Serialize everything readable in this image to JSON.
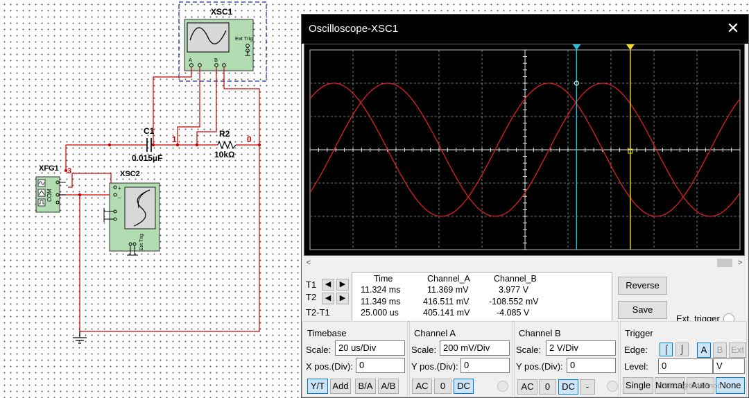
{
  "schematic": {
    "xsc1_label": "XSC1",
    "xsc2_label": "XSC2",
    "xfg1_label": "XFG1",
    "c1_name": "C1",
    "c1_value": "0.015µF",
    "r2_name": "R2",
    "r2_value": "10kΩ",
    "node_1": "1",
    "node_0": "0",
    "node_3": "3",
    "ext_trig": "Ext Trig",
    "terminal_a": "A",
    "terminal_b": "B",
    "com_label": "COM",
    "plus_sign": "+",
    "minus_sign": "_",
    "wire_color": "#cc0000"
  },
  "window": {
    "title": "Oscilloscope-XSC1",
    "close_glyph": "✕",
    "scroll_left": "<",
    "scroll_right": ">"
  },
  "cursors": {
    "t1": "T1",
    "t2": "T2",
    "t2t1": "T2-T1",
    "left_glyph": "◀",
    "right_glyph": "▶",
    "t1_color": "#22c5e0",
    "t2_color": "#f0e02a"
  },
  "readout": {
    "headers": [
      "Time",
      "Channel_A",
      "Channel_B"
    ],
    "rows": [
      [
        "11.324 ms",
        "11.369 mV",
        "3.977 V"
      ],
      [
        "11.349 ms",
        "416.511 mV",
        "-108.552 mV"
      ],
      [
        "25.000 us",
        "405.141 mV",
        "-4.085 V"
      ]
    ]
  },
  "buttons": {
    "reverse": "Reverse",
    "save": "Save",
    "ext_trigger": "Ext. trigger"
  },
  "timebase": {
    "title": "Timebase",
    "scale_label": "Scale:",
    "scale_value": "20 us/Div",
    "xpos_label": "X pos.(Div):",
    "xpos_value": "0",
    "modes": [
      "Y/T",
      "Add",
      "B/A",
      "A/B"
    ],
    "active_mode": "Y/T"
  },
  "channel_a": {
    "title": "Channel A",
    "scale_label": "Scale:",
    "scale_value": "200 mV/Div",
    "ypos_label": "Y pos.(Div):",
    "ypos_value": "0",
    "coupling": [
      "AC",
      "0",
      "DC"
    ],
    "active_coupling": "DC"
  },
  "channel_b": {
    "title": "Channel B",
    "scale_label": "Scale:",
    "scale_value": "2  V/Div",
    "ypos_label": "Y pos.(Div):",
    "ypos_value": "0",
    "coupling": [
      "AC",
      "0",
      "DC",
      "-"
    ],
    "active_coupling": "DC"
  },
  "trigger": {
    "title": "Trigger",
    "edge_label": "Edge:",
    "edge_rising": "⌠",
    "edge_falling": "⌡",
    "sources": [
      "A",
      "B",
      "Ext"
    ],
    "active_source": "A",
    "level_label": "Level:",
    "level_value": "0",
    "level_unit": "V",
    "modes": [
      "Single",
      "Normal",
      "Auto",
      "None"
    ],
    "active_mode": "None"
  },
  "watermark": "CSDN @timelimbo",
  "chart_data": {
    "type": "line",
    "xlabel": "",
    "ylabel": "",
    "grid": true,
    "divisions": {
      "x": 10,
      "y": 6
    },
    "series": [
      {
        "name": "Channel_A",
        "color": "#e02020",
        "phase_deg": 0
      },
      {
        "name": "Channel_B",
        "color": "#e02020",
        "phase_deg": -90
      }
    ],
    "cursor_t1_x_div": 6.2,
    "cursor_t2_x_div": 7.45
  }
}
